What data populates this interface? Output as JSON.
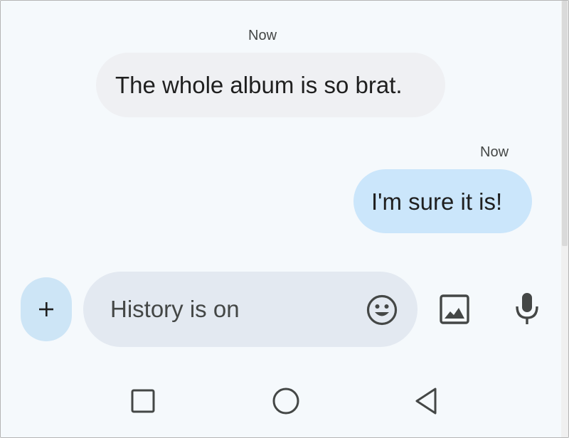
{
  "conversation": {
    "messages": [
      {
        "direction": "incoming",
        "timestamp": "Now",
        "text": "The whole album is so brat."
      },
      {
        "direction": "outgoing",
        "timestamp": "Now",
        "text": "I'm sure it is!"
      }
    ]
  },
  "composer": {
    "add_icon": "plus-icon",
    "placeholder": "History is on",
    "emoji_icon": "emoji-smile-icon",
    "gallery_icon": "image-gallery-icon",
    "mic_icon": "microphone-icon"
  },
  "nav_bar": {
    "icons": [
      "recent-apps-icon",
      "home-icon",
      "back-icon"
    ]
  },
  "colors": {
    "background": "#f5f9fc",
    "incoming_bubble": "#eff0f3",
    "outgoing_bubble": "#cbe6fb",
    "compose_field": "#e3e9f1",
    "add_button": "#cde5f6",
    "icon": "#444746"
  }
}
